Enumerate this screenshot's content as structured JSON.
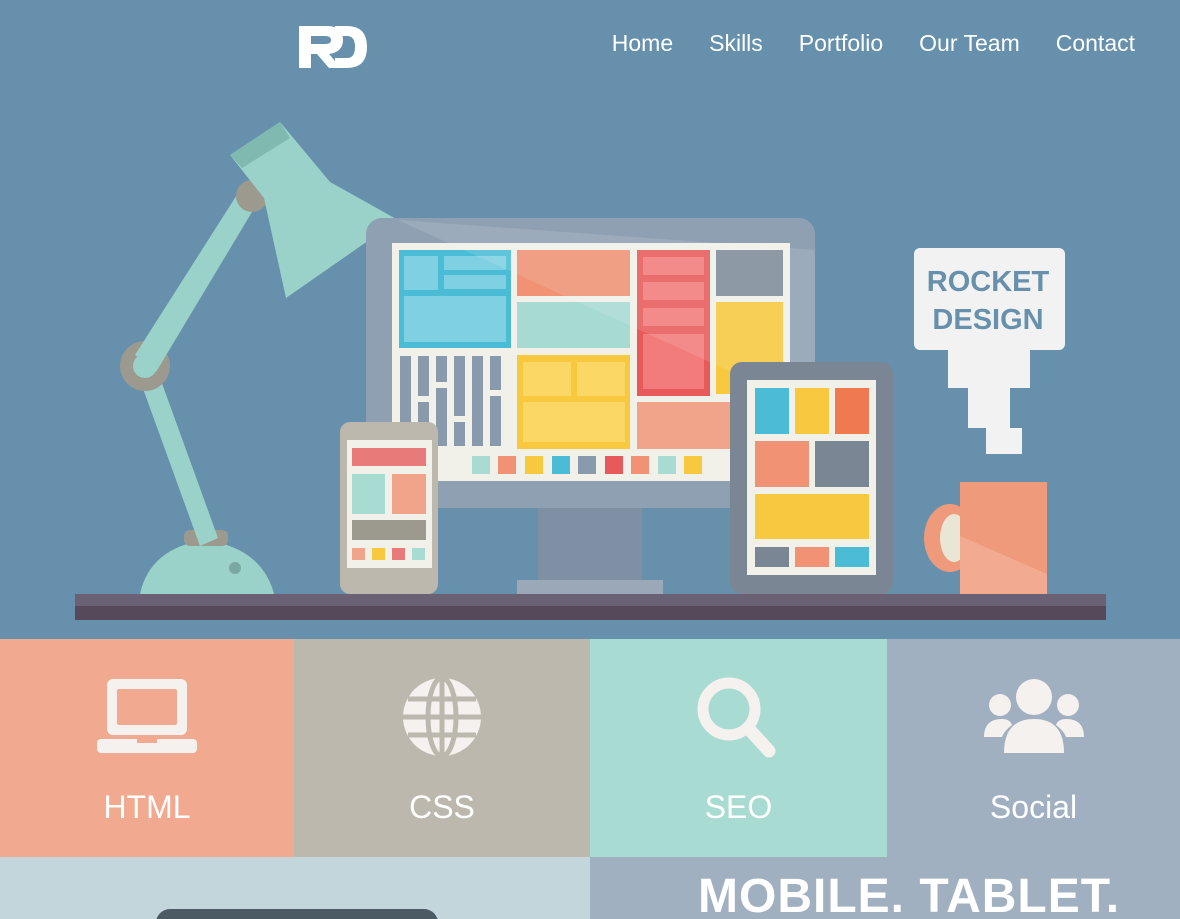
{
  "header": {
    "logo_text": "RD",
    "nav": [
      "Home",
      "Skills",
      "Portfolio",
      "Our Team",
      "Contact"
    ]
  },
  "hero": {
    "sign_line1": "ROCKET",
    "sign_line2": "DESIGN"
  },
  "tiles": [
    {
      "label": "HTML",
      "icon": "laptop-icon",
      "color": "#f1a98f"
    },
    {
      "label": "CSS",
      "icon": "globe-icon",
      "color": "#bdb8ad"
    },
    {
      "label": "SEO",
      "icon": "search-icon",
      "color": "#a8dbd1"
    },
    {
      "label": "Social",
      "icon": "users-icon",
      "color": "#a1b0c1"
    }
  ],
  "section": {
    "heading": "MOBILE. TABLET."
  }
}
